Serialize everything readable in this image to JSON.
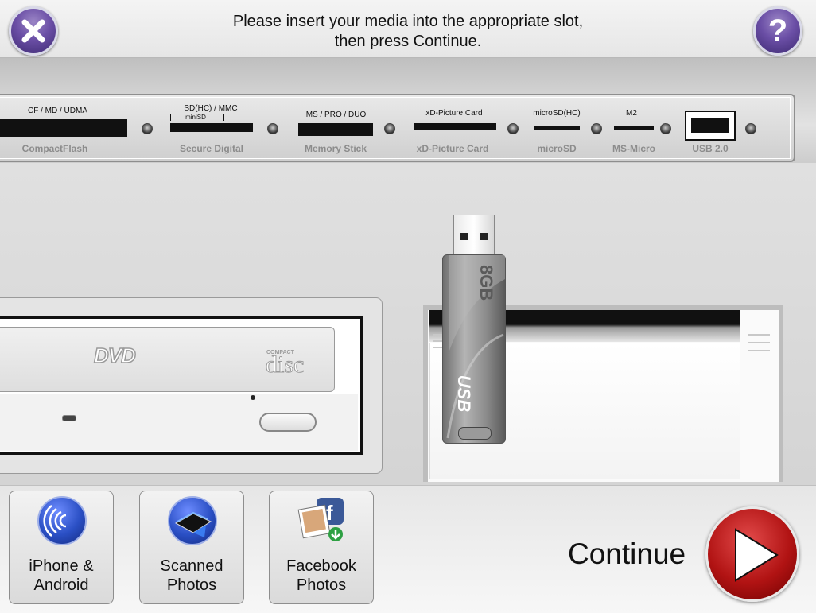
{
  "header": {
    "instruction_line1": "Please insert your media into the appropriate slot,",
    "instruction_line2": "then press Continue."
  },
  "icons": {
    "close": "close-icon",
    "help": "help-icon",
    "help_glyph": "?"
  },
  "slots": [
    {
      "top_label": "CF / MD / UDMA",
      "name": "CompactFlash"
    },
    {
      "top_label": "SD(HC) / MMC",
      "sub_label": "miniSD",
      "name": "Secure Digital"
    },
    {
      "top_label": "MS / PRO / DUO",
      "name": "Memory Stick"
    },
    {
      "top_label": "xD-Picture Card",
      "name": "xD-Picture Card"
    },
    {
      "top_label": "microSD(HC)",
      "name": "microSD"
    },
    {
      "top_label": "M2",
      "name": "MS-Micro"
    },
    {
      "top_label": "",
      "name": "USB 2.0"
    }
  ],
  "devices": {
    "dvd_logo": "DVD",
    "cd_logo": "disc",
    "cd_logo_top": "COMPACT",
    "usb_capacity": "8GB",
    "usb_brand": "USB"
  },
  "sources": [
    {
      "line1": "iPhone &",
      "line2": "Android",
      "icon": "wireless-icon"
    },
    {
      "line1": "Scanned",
      "line2": "Photos",
      "icon": "scanner-icon"
    },
    {
      "line1": "Facebook",
      "line2": "Photos",
      "icon": "facebook-photos-icon"
    }
  ],
  "continue": {
    "label": "Continue"
  },
  "colors": {
    "purple_button": "#6b4fa6",
    "continue_red": "#b11313",
    "slot_name_gray": "#8c8c8c",
    "source_icon_blue": "#2a4fc4"
  }
}
